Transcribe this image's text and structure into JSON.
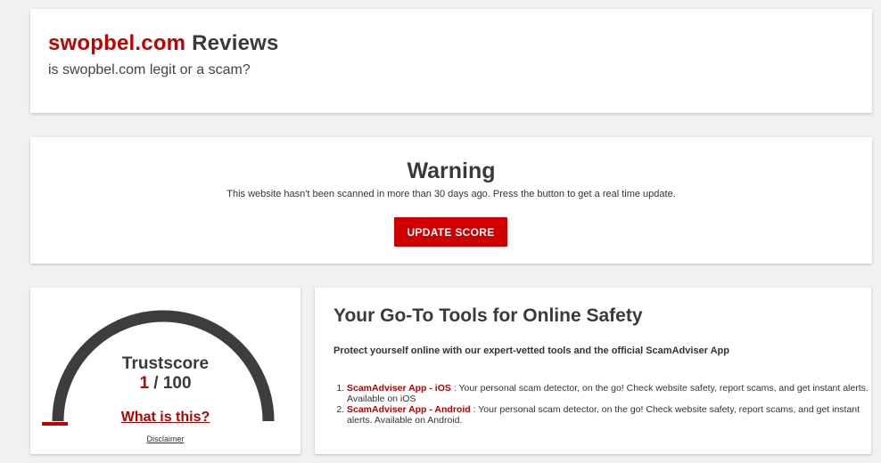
{
  "header": {
    "domain": "swopbel.com",
    "title_rest": " Reviews",
    "subtitle": "is swopbel.com legit or a scam?"
  },
  "warning": {
    "title": "Warning",
    "message": "This website hasn't been scanned in more than 30 days ago. Press the button to get a real time update.",
    "button_label": "UPDATE SCORE"
  },
  "trustscore": {
    "label": "Trustscore",
    "score": "1",
    "max": " / 100",
    "score_value": 1,
    "score_max": 100,
    "what_link": "What is this?",
    "disclaimer": "Disclaimer",
    "colors": {
      "arc": "#3d3d3d",
      "needle": "#c40000"
    }
  },
  "tools": {
    "title": "Your Go-To Tools for Online Safety",
    "intro": "Protect yourself online with our expert-vetted tools and the official ScamAdviser App",
    "items": [
      {
        "name": "ScamAdviser App - iOS",
        "description": " : Your personal scam detector, on the go! Check website safety, report scams, and get instant alerts. Available on iOS"
      },
      {
        "name": "ScamAdviser App - Android",
        "description": " : Your personal scam detector, on the go! Check website safety, report scams, and get instant alerts. Available on Android."
      }
    ]
  },
  "colors": {
    "accent": "#c40000",
    "button": "#d10000",
    "background": "#f1f1f1"
  }
}
